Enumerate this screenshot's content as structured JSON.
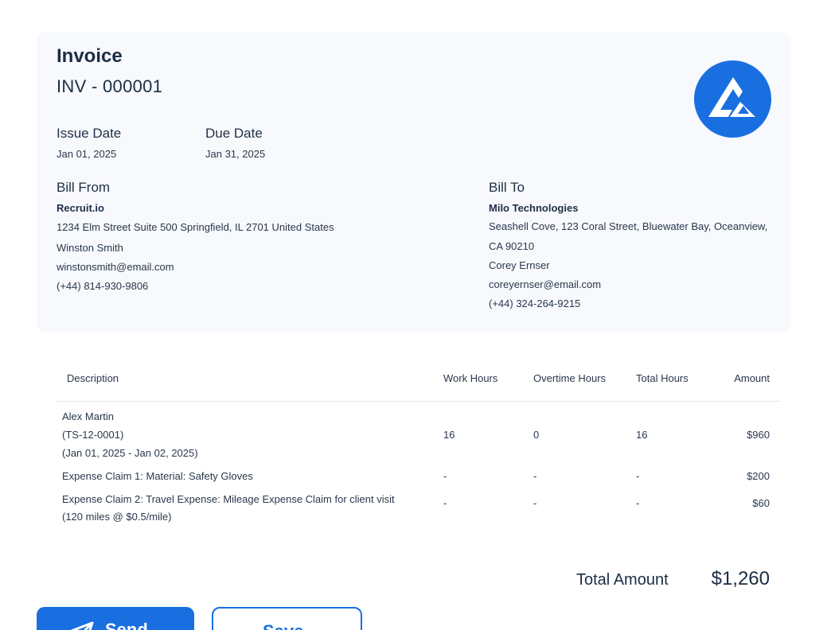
{
  "invoice": {
    "title": "Invoice",
    "number": "INV - 000001",
    "issue_date_label": "Issue Date",
    "issue_date": "Jan 01, 2025",
    "due_date_label": "Due Date",
    "due_date": "Jan 31, 2025"
  },
  "bill_from": {
    "label": "Bill From",
    "company": "Recruit.io",
    "address": "1234 Elm Street Suite 500 Springfield, IL 2701 United States",
    "contact": "Winston Smith",
    "email": "winstonsmith@email.com",
    "phone": "(+44) 814-930-9806"
  },
  "bill_to": {
    "label": "Bill To",
    "company": "Milo Technologies",
    "address_line1": "Seashell Cove, 123 Coral Street, Bluewater Bay, Oceanview,",
    "address_line2": "CA 90210",
    "contact": "Corey Ernser",
    "email": "coreyernser@email.com",
    "phone": "(+44) 324-264-9215"
  },
  "table": {
    "headers": {
      "description": "Description",
      "work_hours": "Work Hours",
      "overtime_hours": "Overtime Hours",
      "total_hours": "Total Hours",
      "amount": "Amount"
    },
    "rows": [
      {
        "desc_line1": "Alex Martin",
        "desc_line2": "(TS-12-0001)",
        "desc_line3": "(Jan 01, 2025 - Jan 02, 2025)",
        "work_hours": "16",
        "overtime_hours": "0",
        "total_hours": "16",
        "amount": "$960"
      },
      {
        "desc_line1": "Expense Claim 1: Material: Safety Gloves",
        "work_hours": "-",
        "overtime_hours": "-",
        "total_hours": "-",
        "amount": "$200"
      },
      {
        "desc_line1": "Expense Claim 2: Travel Expense: Mileage Expense Claim for client visit",
        "desc_line2": "(120 miles @ $0.5/mile)",
        "work_hours": "-",
        "overtime_hours": "-",
        "total_hours": "-",
        "amount": "$60"
      }
    ]
  },
  "total": {
    "label": "Total Amount",
    "value": "$1,260"
  },
  "actions": {
    "send_label": "Send",
    "save_label": "Save"
  },
  "colors": {
    "accent": "#1a6fe0",
    "card_bg": "#f7f9fd",
    "text": "#1b2d44"
  },
  "icons": {
    "logo": "company-logo-icon",
    "send": "paper-plane-icon"
  }
}
